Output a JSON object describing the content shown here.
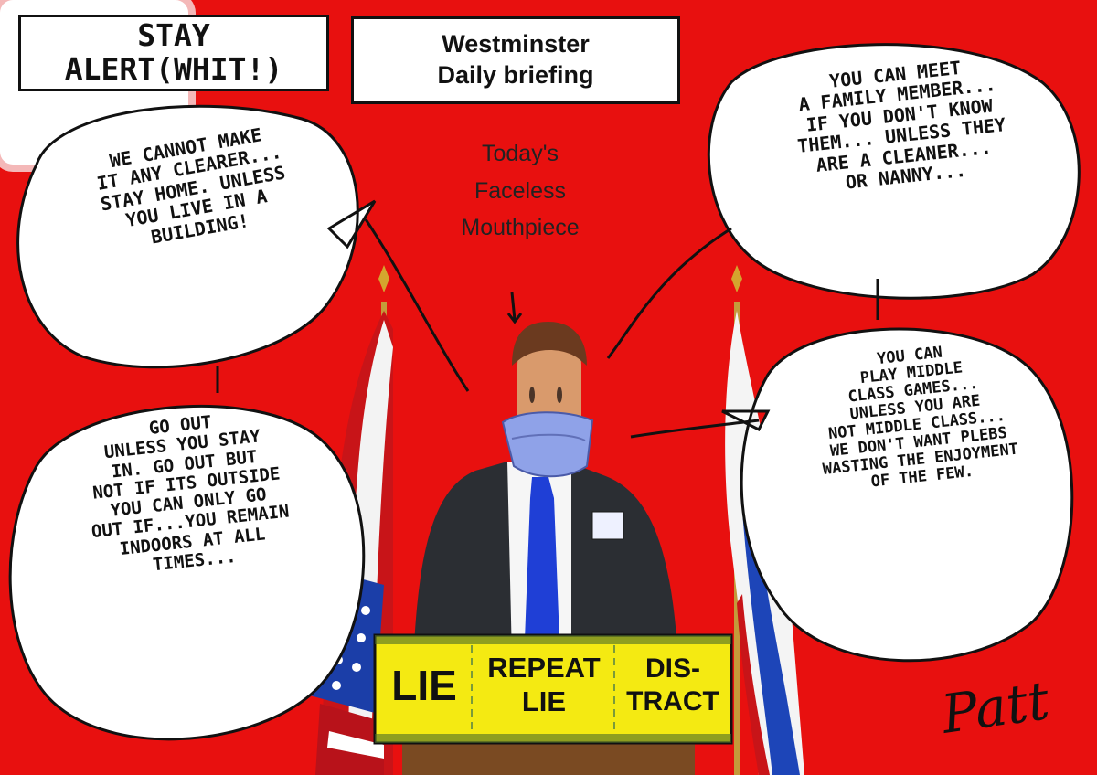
{
  "stay_alert": "STAY ALERT(WHIT!)",
  "header": {
    "line1": "Westminster",
    "line2": "Daily briefing"
  },
  "caption": "Today's\nFaceless\nMouthpiece",
  "bubbles": {
    "top_left": "We cannot make\nit any clearer...\nstay home. unless\nyou live in a\nbuilding!",
    "bottom_left": "Go out\nunless you stay\nin. Go out but\nnot if its outside\nyou can only go\nout if...you remain\nindoors at all\ntimes...",
    "top_right": "You can meet\na family member...\nif you don't know\nthem... unless they\nare a cleaner...\nor nanny...",
    "bottom_right": "You can\nplay middle\nclass games...\nunless you are\nnot middle class...\nwe don't want plebs\nwasting the enjoyment\nof the few."
  },
  "lectern": {
    "word1": "LIE",
    "word2": "REPEAT\nLIE",
    "word3": "DIS-\nTRACT"
  },
  "signature": "Patt",
  "colors": {
    "background": "#e8100f",
    "tie": "#1f3fd6",
    "mask": "#8fa2e8",
    "lectern_yellow": "#f4ea12",
    "suit": "#2b2e33"
  }
}
